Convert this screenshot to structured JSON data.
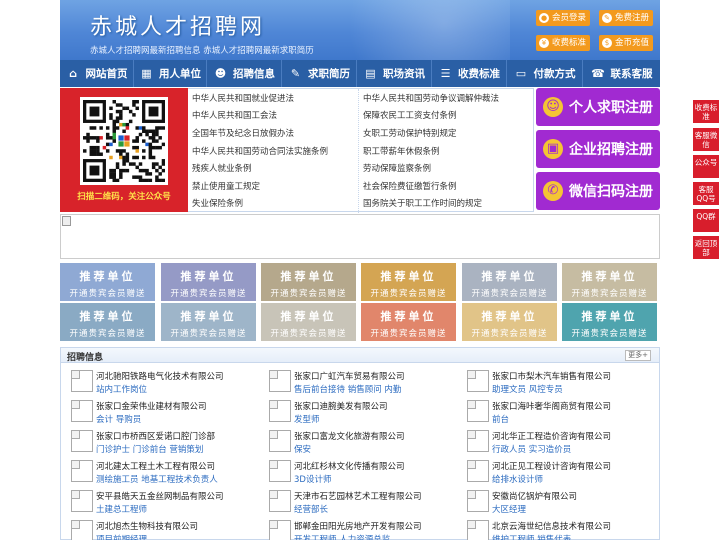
{
  "header": {
    "title": "赤城人才招聘网",
    "subtitle": "赤城人才招聘网最新招聘信息   赤城人才招聘网最新求职简历",
    "buttons": [
      {
        "label": "会员登录",
        "icon": "user-icon"
      },
      {
        "label": "免费注册",
        "icon": "register-icon"
      },
      {
        "label": "收费标准",
        "icon": "price-icon"
      },
      {
        "label": "金币充值",
        "icon": "coin-icon"
      }
    ],
    "accent": "#f39a1e"
  },
  "nav": [
    {
      "label": "网站首页",
      "icon": "home-icon"
    },
    {
      "label": "用人单位",
      "icon": "building-icon"
    },
    {
      "label": "招聘信息",
      "icon": "people-icon"
    },
    {
      "label": "求职简历",
      "icon": "resume-icon"
    },
    {
      "label": "职场资讯",
      "icon": "news-icon"
    },
    {
      "label": "收费标准",
      "icon": "fee-icon"
    },
    {
      "label": "付款方式",
      "icon": "payment-icon"
    },
    {
      "label": "联系客服",
      "icon": "phone-icon"
    }
  ],
  "qr": {
    "caption": "扫描二维码，关注公众号"
  },
  "laws": {
    "left": [
      "中华人民共和国就业促进法",
      "中华人民共和国工会法",
      "全国年节及纪念日放假办法",
      "中华人民共和国劳动合同法实施条例",
      "残疾人就业条例",
      "禁止使用童工规定",
      "失业保险条例"
    ],
    "right": [
      "中华人民共和国劳动争议调解仲裁法",
      "保障农民工工资支付条例",
      "女职工劳动保护特别规定",
      "职工带薪年休假条例",
      "劳动保障监察条例",
      "社会保险费征缴暂行条例",
      "国务院关于职工工作时间的规定"
    ]
  },
  "register": [
    {
      "label": "个人求职注册",
      "icon": "person-icon"
    },
    {
      "label": "企业招聘注册",
      "icon": "company-icon"
    },
    {
      "label": "微信扫码注册",
      "icon": "wechat-icon"
    }
  ],
  "units": {
    "title": "推荐单位",
    "subtitle": "开通贵宾会员赠送",
    "colors": [
      "#8fa9d4",
      "#959ac6",
      "#b5a88c",
      "#d4a553",
      "#aab3c1",
      "#c6bca2",
      "#8aaac4",
      "#9eb5c9",
      "#c8c4b8",
      "#e1866b",
      "#e1c488",
      "#4fa4ae"
    ]
  },
  "jobs": {
    "title": "招聘信息",
    "more": "更多+",
    "items": [
      {
        "company": "河北驰阳铁路电气化技术有限公司",
        "positions": "站内工作岗位"
      },
      {
        "company": "张家口广虹汽车贸易有限公司",
        "positions": "售后前台接待 销售顾问 内勤"
      },
      {
        "company": "张家口市梨木汽车销售有限公司",
        "positions": "助理文员 风控专员"
      },
      {
        "company": "张家口金荣伟业建材有限公司",
        "positions": "会计 导购员"
      },
      {
        "company": "张家口迪腕美发有限公司",
        "positions": "发型师"
      },
      {
        "company": "张家口海咔奢华阁商贸有限公司",
        "positions": "前台"
      },
      {
        "company": "张家口市桥西区爱诺口腔门诊部",
        "positions": "门诊护士 门诊前台 营销策划"
      },
      {
        "company": "张家口富龙文化旅游有限公司",
        "positions": "保安"
      },
      {
        "company": "河北华正工程造价咨询有限公司",
        "positions": "行政人员 实习造价员"
      },
      {
        "company": "河北建太工程土木工程有限公司",
        "positions": "测绘施工员 地基工程技术负责人"
      },
      {
        "company": "河北红杉林文化传播有限公司",
        "positions": "3D设计师"
      },
      {
        "company": "河北正见工程设计咨询有限公司",
        "positions": "给排水设计师"
      },
      {
        "company": "安平县皓天五金丝网制品有限公司",
        "positions": "土建总工程师"
      },
      {
        "company": "天津市石艺园林艺术工程有限公司",
        "positions": "经营部长"
      },
      {
        "company": "安徽尚亿锅炉有限公司",
        "positions": "大区经理"
      },
      {
        "company": "河北旭杰生物科技有限公司",
        "positions": "项目前期经理"
      },
      {
        "company": "邯郸金田阳光房地产开发有限公司",
        "positions": "开发工程师 人力资源总监"
      },
      {
        "company": "北京云海世纪信息技术有限公司",
        "positions": "维护工程师 销售代表"
      }
    ]
  },
  "side": [
    "收费标准",
    "客服微信",
    "公众号",
    "客服QQ号",
    "QQ群",
    "返回顶部"
  ],
  "side_color": "#d81e2c",
  "nav_color": "#2a5fa5",
  "register_color": "#a12ad1"
}
